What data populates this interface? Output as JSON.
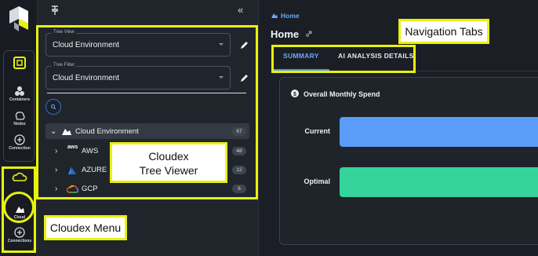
{
  "rail": {
    "items": [
      {
        "label": "Containers",
        "icon": "containers-icon"
      },
      {
        "label": "Nodes",
        "icon": "nodes-icon"
      },
      {
        "label": "Connection",
        "icon": "connection-icon"
      },
      {
        "label": "Cloud",
        "icon": "cloud-icon"
      },
      {
        "label": "Connections",
        "icon": "connections-icon"
      }
    ]
  },
  "tree": {
    "collapse_icon": "«",
    "pin_icon": "pin-icon",
    "tree_view": {
      "legend": "Tree View",
      "value": "Cloud Environment"
    },
    "tree_filter": {
      "legend": "Tree Filter",
      "value": "Cloud Environment"
    },
    "nodes": [
      {
        "label": "Cloud Environment",
        "count": "67"
      },
      {
        "label": "AWS",
        "count": "48",
        "logo": "aws"
      },
      {
        "label": "AZURE",
        "count": "12"
      },
      {
        "label": "GCP",
        "count": "6"
      }
    ]
  },
  "main": {
    "breadcrumb": "Home",
    "title": "Home",
    "tabs": [
      {
        "label": "SUMMARY",
        "active": true
      },
      {
        "label": "AI ANALYSIS DETAILS",
        "active": false
      }
    ],
    "card": {
      "title": "Overall Monthly Spend"
    }
  },
  "chart_data": {
    "type": "bar",
    "orientation": "horizontal",
    "title": "Overall Monthly Spend",
    "categories": [
      "Current",
      "Optimal"
    ],
    "colors": [
      "#5a9cf8",
      "#35d49a"
    ]
  },
  "annotations": {
    "tree_viewer": [
      "Cloudex",
      "Tree Viewer"
    ],
    "menu": "Cloudex Menu",
    "tabs": "Navigation Tabs"
  },
  "colors": {
    "accent": "#5c95e8",
    "highlight": "#e8f20e",
    "current_bar": "#5a9cf8",
    "optimal_bar": "#35d49a"
  }
}
